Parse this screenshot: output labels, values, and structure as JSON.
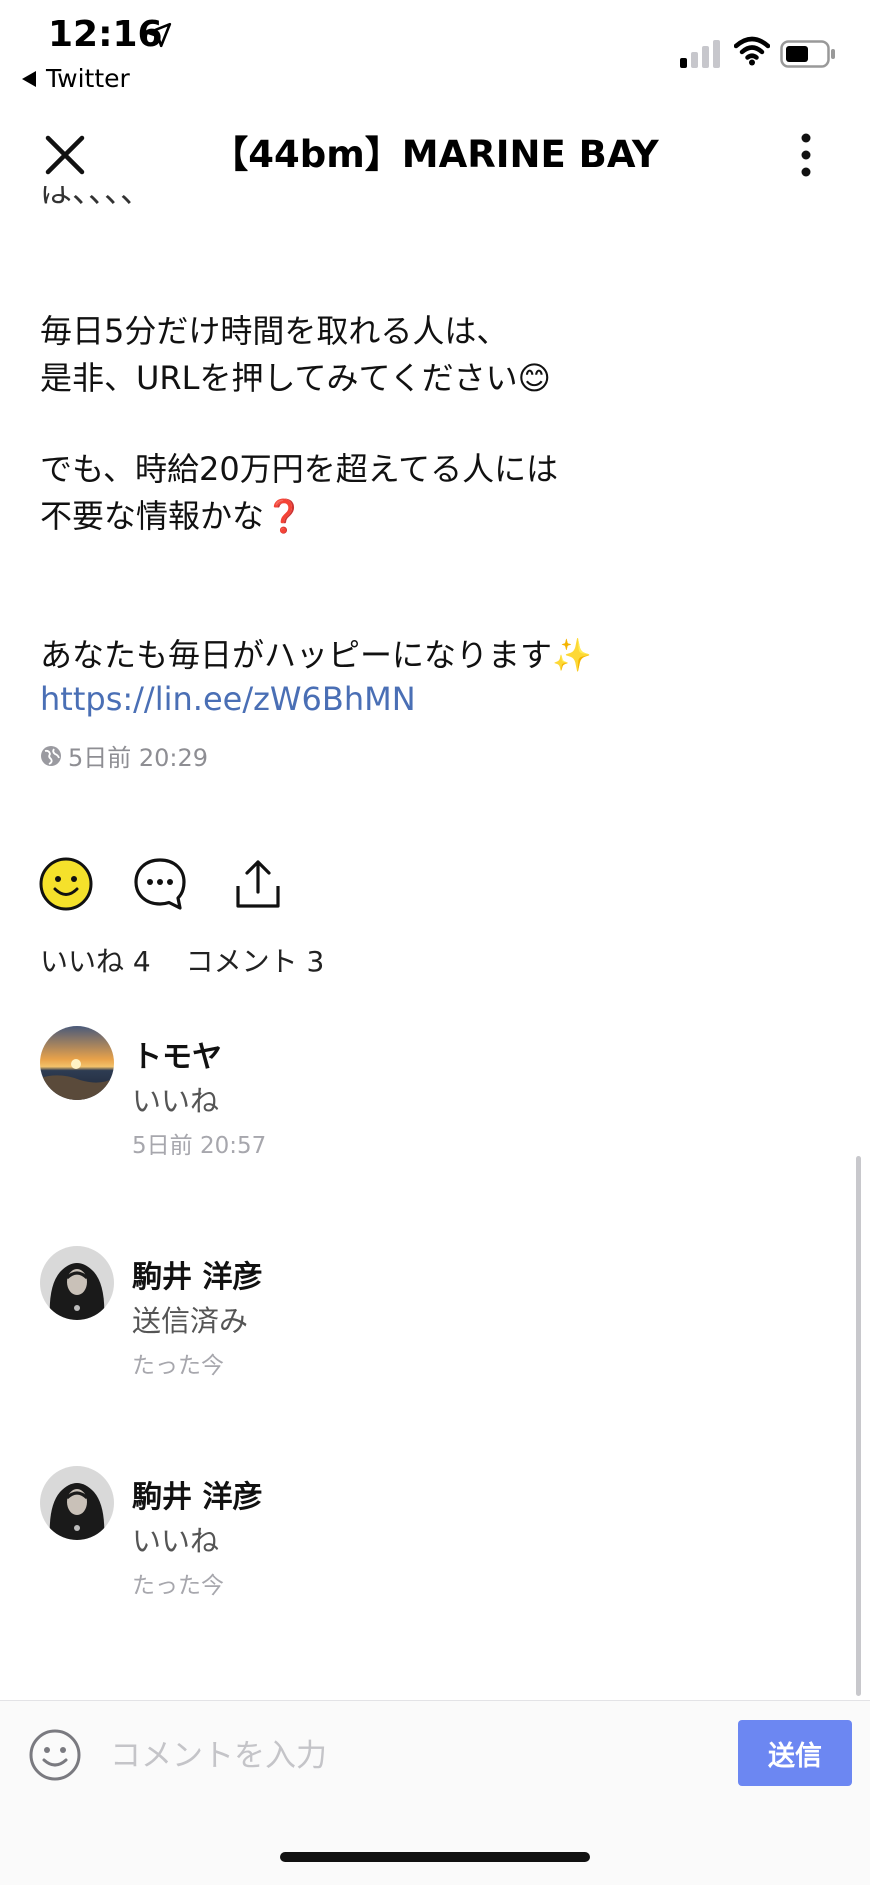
{
  "status_bar": {
    "time": "12:16",
    "back_app": "Twitter"
  },
  "header": {
    "title": "【44bm】MARINE BAY"
  },
  "post": {
    "cut_line": "は、、、、",
    "paragraph1": [
      "毎日5分だけ時間を取れる人は、",
      "是非、URLを押してみてください😊"
    ],
    "paragraph2": [
      "でも、時給20万円を超えてる人には",
      "不要な情報かな❓"
    ],
    "paragraph3": "あなたも毎日がハッピーになります✨",
    "link": "https://lin.ee/zW6BhMN",
    "timestamp": "5日前 20:29"
  },
  "counts": {
    "likes": "いいね 4",
    "comments": "コメント 3"
  },
  "comments": [
    {
      "name": "トモヤ",
      "text": "いいね",
      "time": "5日前 20:57"
    },
    {
      "name": "駒井 洋彦",
      "text": "送信済み",
      "time": "たった今"
    },
    {
      "name": "駒井 洋彦",
      "text": "いいね",
      "time": "たった今"
    }
  ],
  "input": {
    "placeholder": "コメントを入力",
    "send_label": "送信"
  },
  "colors": {
    "link": "#4a6fb5",
    "send_button": "#6c87f2",
    "like_face": "#f5e12b"
  },
  "icons": {
    "close": "close-icon",
    "more": "more-vertical-icon",
    "like": "smiley-face-icon",
    "comment": "comment-bubble-icon",
    "share": "share-icon",
    "globe": "globe-icon",
    "emoji": "emoji-icon"
  }
}
